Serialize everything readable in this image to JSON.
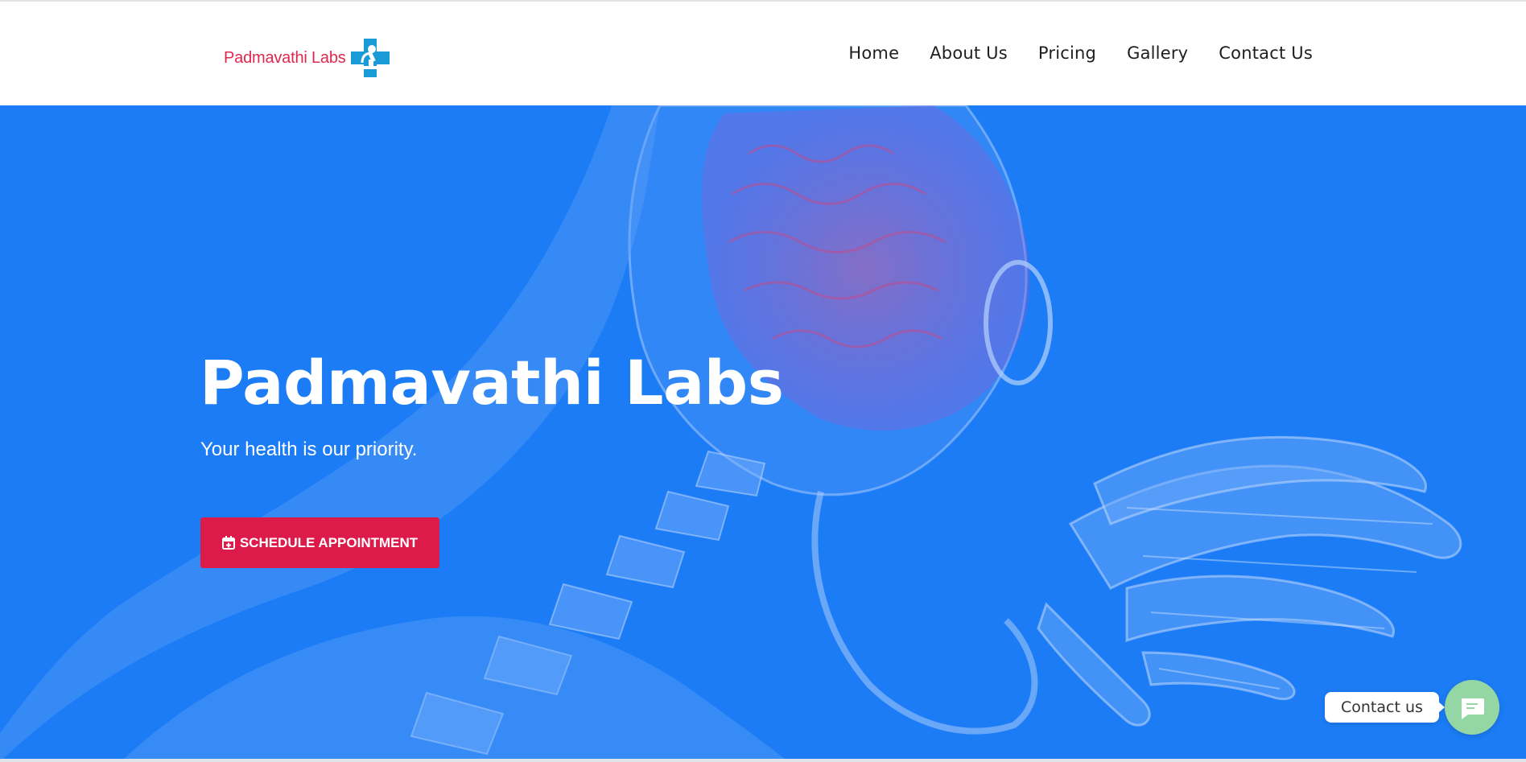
{
  "brand": {
    "name": "Padmavathi Labs",
    "logo_icon": "microscope-cross-icon"
  },
  "nav": {
    "items": [
      {
        "label": "Home"
      },
      {
        "label": "About Us"
      },
      {
        "label": "Pricing"
      },
      {
        "label": "Gallery"
      },
      {
        "label": "Contact Us"
      }
    ]
  },
  "hero": {
    "title": "Padmavathi Labs",
    "subtitle": "Your health is our priority.",
    "cta_label": "SCHEDULE APPOINTMENT",
    "cta_icon": "calendar-plus-icon",
    "background_image": "x-ray-head-hand-illustration"
  },
  "chat": {
    "label": "Contact us",
    "icon": "chat-bubble-icon"
  },
  "colors": {
    "hero_bg": "#1c7cf6",
    "cta_bg": "#dc1b4b",
    "logo_text": "#e0284f",
    "chat_button": "#94d6a4"
  }
}
